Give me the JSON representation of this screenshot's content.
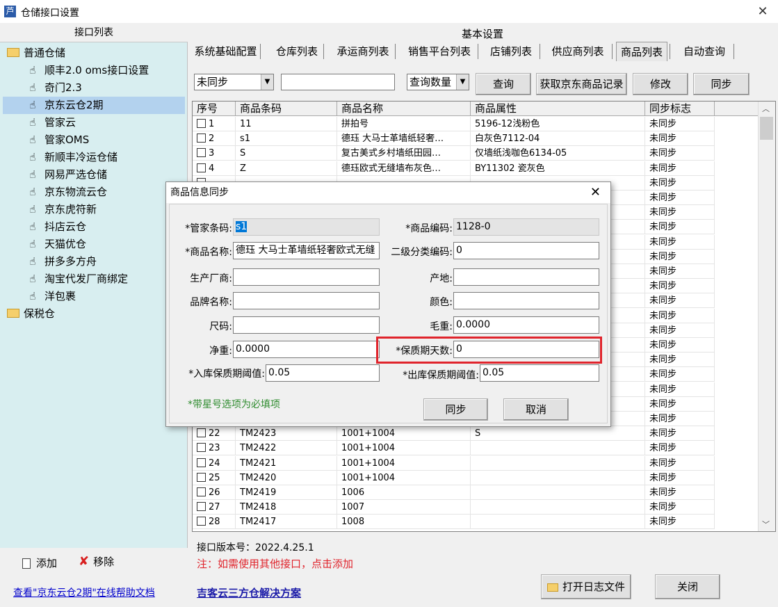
{
  "window": {
    "title": "仓储接口设置",
    "icon_char": "芦"
  },
  "left": {
    "header": "接口列表",
    "items": [
      {
        "label": "普通仓储",
        "kind": "folder"
      },
      {
        "label": "顺丰2.0 oms接口设置",
        "kind": "hand"
      },
      {
        "label": "奇门2.3",
        "kind": "hand"
      },
      {
        "label": "京东云仓2期",
        "kind": "hand",
        "selected": true
      },
      {
        "label": "管家云",
        "kind": "hand"
      },
      {
        "label": "管家OMS",
        "kind": "hand"
      },
      {
        "label": "新顺丰冷运仓储",
        "kind": "hand"
      },
      {
        "label": "网易严选仓储",
        "kind": "hand"
      },
      {
        "label": "京东物流云仓",
        "kind": "hand"
      },
      {
        "label": "京东虎符新",
        "kind": "hand"
      },
      {
        "label": "抖店云仓",
        "kind": "hand"
      },
      {
        "label": "天猫优仓",
        "kind": "hand"
      },
      {
        "label": "拼多多方舟",
        "kind": "hand"
      },
      {
        "label": "淘宝代发厂商绑定",
        "kind": "hand"
      },
      {
        "label": "洋包裹",
        "kind": "hand"
      },
      {
        "label": "保税仓",
        "kind": "folder"
      }
    ],
    "add_label": "添加",
    "remove_label": "移除",
    "help_link": "查看\"京东云仓2期\"在线帮助文档"
  },
  "right": {
    "header": "基本设置",
    "tabs": [
      "系统基础配置",
      "仓库列表",
      "承运商列表",
      "销售平台列表",
      "店铺列表",
      "供应商列表",
      "商品列表",
      "自动查询"
    ],
    "active_tab": "商品列表",
    "filter": {
      "sync_status": "未同步",
      "keyword": "",
      "query_field": "查询数量"
    },
    "buttons": {
      "query": "查询",
      "fetch": "获取京东商品记录",
      "modify": "修改",
      "sync": "同步"
    },
    "columns": [
      "序号",
      "商品条码",
      "商品名称",
      "商品属性",
      "同步标志"
    ],
    "rows": [
      {
        "no": "1",
        "barcode": "11",
        "name": "拼拍号",
        "attr": "5196-12浅粉色",
        "flag": "未同步"
      },
      {
        "no": "2",
        "barcode": "s1",
        "name": "德珏 大马士革墙纸轻奢…",
        "attr": "白灰色7112-04",
        "flag": "未同步"
      },
      {
        "no": "3",
        "barcode": "S",
        "name": "复古美式乡村墙纸田园…",
        "attr": "仅墙纸浅咖色6134-05",
        "flag": "未同步"
      },
      {
        "no": "4",
        "barcode": "Z",
        "name": "德珏欧式无缝墙布灰色…",
        "attr": "BY11302 瓷灰色",
        "flag": "未同步"
      },
      {
        "no": "",
        "barcode": "",
        "name": "",
        "attr": "",
        "flag": "未同步"
      },
      {
        "no": "",
        "barcode": "",
        "name": "",
        "attr": "",
        "flag": "未同步"
      },
      {
        "no": "",
        "barcode": "",
        "name": "",
        "attr": "",
        "flag": "未同步"
      },
      {
        "no": "",
        "barcode": "",
        "name": "",
        "attr": "",
        "flag": "未同步"
      },
      {
        "no": "",
        "barcode": "",
        "name": "",
        "attr": "",
        "flag": "未同步"
      },
      {
        "no": "",
        "barcode": "",
        "name": "",
        "attr": "",
        "flag": "未同步"
      },
      {
        "no": "",
        "barcode": "",
        "name": "",
        "attr": "",
        "flag": "未同步"
      },
      {
        "no": "",
        "barcode": "",
        "name": "",
        "attr": "",
        "flag": "未同步"
      },
      {
        "no": "",
        "barcode": "",
        "name": "",
        "attr": "",
        "flag": "未同步"
      },
      {
        "no": "",
        "barcode": "",
        "name": "",
        "attr": "",
        "flag": "未同步"
      },
      {
        "no": "",
        "barcode": "",
        "name": "",
        "attr": "",
        "flag": "未同步"
      },
      {
        "no": "",
        "barcode": "",
        "name": "",
        "attr": "",
        "flag": "未同步"
      },
      {
        "no": "",
        "barcode": "",
        "name": "",
        "attr": "",
        "flag": "未同步"
      },
      {
        "no": "",
        "barcode": "",
        "name": "",
        "attr": "",
        "flag": "未同步"
      },
      {
        "no": "",
        "barcode": "",
        "name": "",
        "attr": "",
        "flag": "未同步"
      },
      {
        "no": "",
        "barcode": "",
        "name": "",
        "attr": "",
        "flag": "未同步"
      },
      {
        "no": "",
        "barcode": "",
        "name": "",
        "attr": "",
        "flag": "未同步"
      },
      {
        "no": "22",
        "barcode": "TM2423",
        "name": "1001+1004",
        "attr": "S",
        "flag": "未同步"
      },
      {
        "no": "23",
        "barcode": "TM2422",
        "name": "1001+1004",
        "attr": "",
        "flag": "未同步"
      },
      {
        "no": "24",
        "barcode": "TM2421",
        "name": "1001+1004",
        "attr": "",
        "flag": "未同步"
      },
      {
        "no": "25",
        "barcode": "TM2420",
        "name": "1001+1004",
        "attr": "",
        "flag": "未同步"
      },
      {
        "no": "26",
        "barcode": "TM2419",
        "name": "1006",
        "attr": "",
        "flag": "未同步"
      },
      {
        "no": "27",
        "barcode": "TM2418",
        "name": "1007",
        "attr": "",
        "flag": "未同步"
      },
      {
        "no": "28",
        "barcode": "TM2417",
        "name": "1008",
        "attr": "",
        "flag": "未同步"
      }
    ],
    "version": "接口版本号：2022.4.25.1",
    "note": "注：如需使用其他接口，点击添加",
    "solution_link": "吉客云三方仓解决方案",
    "open_log": "打开日志文件",
    "close": "关闭"
  },
  "dialog": {
    "title": "商品信息同步",
    "fields": {
      "gj_barcode": {
        "label": "*管家条码:",
        "value": "s1"
      },
      "item_code": {
        "label": "*商品编码:",
        "value": "1128-0"
      },
      "item_name": {
        "label": "*商品名称:",
        "value": "德珏 大马士革墙纸轻奢欧式无缝"
      },
      "cat2_code": {
        "label": "二级分类编码:",
        "value": "0"
      },
      "manufacturer": {
        "label": "生产厂商:",
        "value": ""
      },
      "origin": {
        "label": "产地:",
        "value": ""
      },
      "brand": {
        "label": "品牌名称:",
        "value": ""
      },
      "color": {
        "label": "颜色:",
        "value": ""
      },
      "size": {
        "label": "尺码:",
        "value": ""
      },
      "gross_weight": {
        "label": "毛重:",
        "value": "0.0000"
      },
      "net_weight": {
        "label": "净重:",
        "value": "0.0000"
      },
      "shelf_days": {
        "label": "*保质期天数:",
        "value": "0"
      },
      "in_threshold": {
        "label": "*入库保质期阈值:",
        "value": "0.05"
      },
      "out_threshold": {
        "label": "*出库保质期阈值:",
        "value": "0.05"
      }
    },
    "required_note": "*带星号选项为必填项",
    "sync": "同步",
    "cancel": "取消",
    "colors": {
      "note": "#2e8b2e",
      "highlight": "#e0242c"
    }
  }
}
